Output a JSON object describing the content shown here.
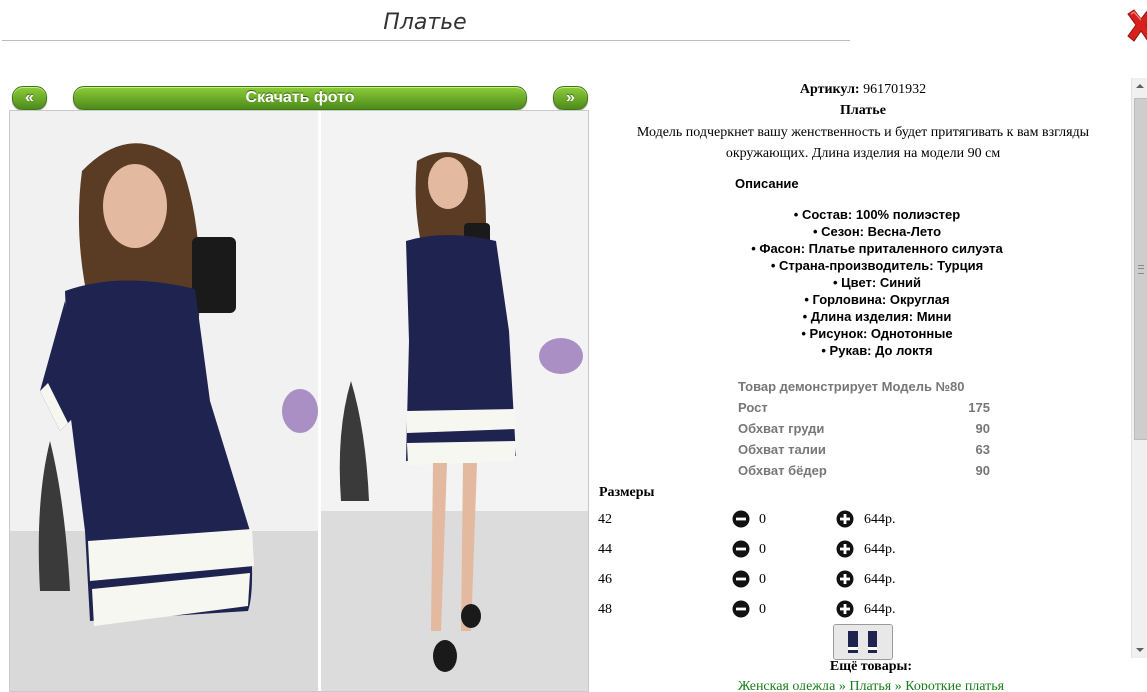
{
  "header": {
    "title": "Платье"
  },
  "gallery": {
    "prev_label": "«",
    "next_label": "»",
    "download_label": "Скачать фото"
  },
  "product": {
    "sku_label": "Артикул:",
    "sku_value": "961701932",
    "name": "Платье",
    "description_line1": "Модель подчеркнет вашу женственность и будет притягивать к вам взгляды",
    "description_line2": "окружающих. Длина изделия на модели 90 см",
    "description_heading": "Описание",
    "specs": [
      "• Состав: 100% полиэстер",
      "• Сезон: Весна-Лето",
      "• Фасон: Платье приталенного силуэта",
      "• Страна-производитель: Турция",
      "• Цвет: Синий",
      "• Горловина: Округлая",
      "• Длина изделия: Мини",
      "• Рисунок: Однотонные",
      "• Рукав: До локтя"
    ]
  },
  "model": {
    "heading": "Товар демонстрирует Модель №80",
    "rows": [
      {
        "label": "Рост",
        "value": "175"
      },
      {
        "label": "Обхват груди",
        "value": "90"
      },
      {
        "label": "Обхват талии",
        "value": "63"
      },
      {
        "label": "Обхват бёдер",
        "value": "90"
      }
    ]
  },
  "sizes": {
    "heading": "Размеры",
    "rows": [
      {
        "size": "42",
        "qty": "0",
        "price": "644р."
      },
      {
        "size": "44",
        "qty": "0",
        "price": "644р."
      },
      {
        "size": "46",
        "qty": "0",
        "price": "644р."
      },
      {
        "size": "48",
        "qty": "0",
        "price": "644р."
      }
    ]
  },
  "more": {
    "heading": "Ещё товары:",
    "crumbs": [
      "Женская одежда",
      "Платья",
      "Короткие платья"
    ],
    "separator": "»"
  },
  "colors": {
    "accent_green": "#6aa82a",
    "close_red": "#d8201c",
    "dress_navy": "#1f2350",
    "link_green": "#1a7f1a"
  }
}
